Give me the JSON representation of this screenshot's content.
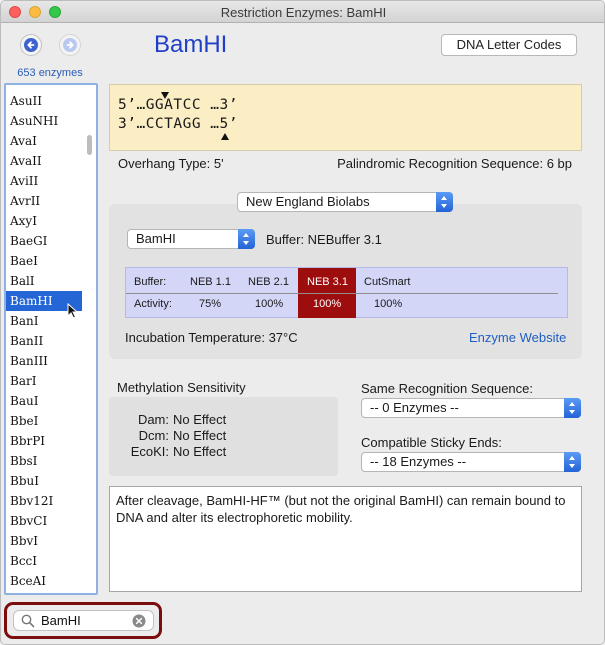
{
  "window": {
    "title": "Restriction Enzymes: BamHI"
  },
  "nav": {
    "enzyme_count": "653 enzymes"
  },
  "header": {
    "title": "BamHI",
    "dna_codes_label": "DNA Letter Codes"
  },
  "enzyme_list": {
    "items": [
      "AsuII",
      "AsuNHI",
      "AvaI",
      "AvaII",
      "AviII",
      "AvrII",
      "AxyI",
      "BaeGI",
      "BaeI",
      "BalI",
      "BamHI",
      "BanI",
      "BanII",
      "BanIII",
      "BarI",
      "BauI",
      "BbeI",
      "BbrPI",
      "BbsI",
      "BbuI",
      "Bbv12I",
      "BbvCI",
      "BbvI",
      "BccI",
      "BceAI"
    ],
    "selected": "BamHI"
  },
  "sequence": {
    "top": "5’…GGATCC …3’",
    "bottom": "3’…CCTAGG …5’"
  },
  "info": {
    "overhang": "Overhang Type:  5'",
    "palindromic": "Palindromic Recognition Sequence:  6 bp"
  },
  "supplier": {
    "selected": "New England Biolabs"
  },
  "buffer": {
    "enzyme_select": "BamHI",
    "label": "Buffer:  NEBuffer 3.1",
    "row_labels": [
      "Buffer:",
      "Activity:"
    ],
    "columns": [
      {
        "buffer": "NEB 1.1",
        "activity": "75%"
      },
      {
        "buffer": "NEB 2.1",
        "activity": "100%"
      },
      {
        "buffer": "NEB 3.1",
        "activity": "100%"
      },
      {
        "buffer": "CutSmart",
        "activity": "100%"
      }
    ],
    "highlight_color": "#9e0d0d",
    "incubation": "Incubation Temperature:  37°C",
    "website_link": "Enzyme Website"
  },
  "methylation": {
    "title": "Methylation Sensitivity",
    "rows": [
      {
        "key": "Dam:",
        "value": "No Effect"
      },
      {
        "key": "Dcm:",
        "value": "No Effect"
      },
      {
        "key": "EcoKI:",
        "value": "No Effect"
      }
    ]
  },
  "same_recognition": {
    "label": "Same Recognition Sequence:",
    "selected": "-- 0 Enzymes --"
  },
  "compatible_ends": {
    "label": "Compatible Sticky Ends:",
    "selected": "-- 18 Enzymes --"
  },
  "notes": "After cleavage, BamHI-HF™ (but not the original BamHI) can remain bound to DNA and alter its electrophoretic mobility.",
  "search": {
    "value": "BamHI"
  },
  "icons": [
    "back-arrow-icon",
    "forward-arrow-icon",
    "search-icon",
    "clear-icon",
    "pointer-cursor-icon"
  ]
}
